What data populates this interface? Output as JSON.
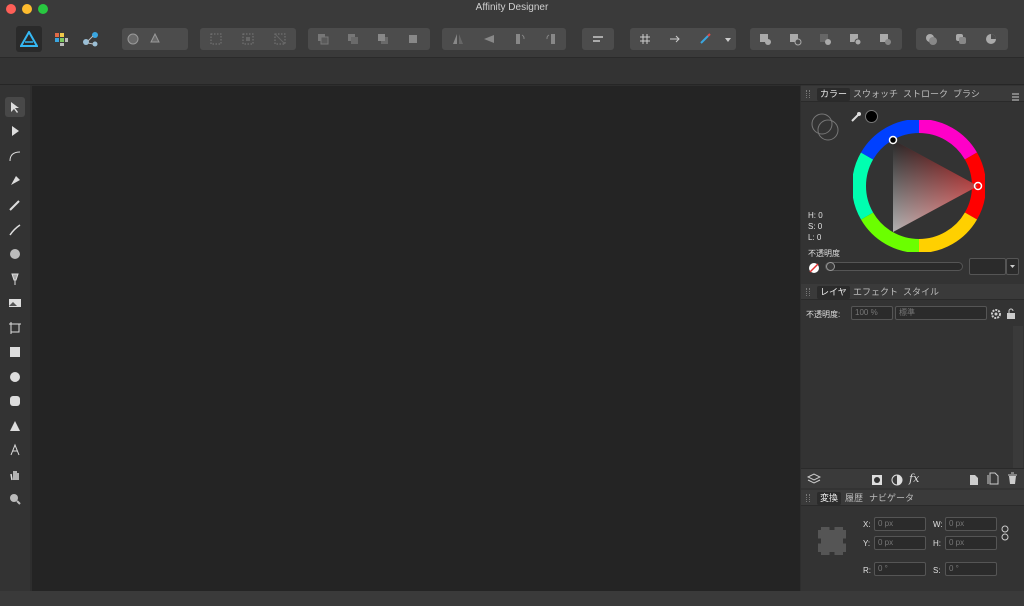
{
  "window": {
    "title": "Affinity Designer"
  },
  "colors": {
    "accent": "#1f8fd6",
    "panel_bg": "#333333",
    "canvas_bg": "#242424",
    "toolbar_bg": "#3a3a3a"
  },
  "color_panel": {
    "tabs": [
      "カラー",
      "スウォッチ",
      "ストローク",
      "ブラシ"
    ],
    "hsl": {
      "h": "H: 0",
      "s": "S: 0",
      "l": "L: 0"
    },
    "opacity_label": "不透明度"
  },
  "layers_panel": {
    "tabs": [
      "レイヤ",
      "エフェクト",
      "スタイル"
    ],
    "opacity_label": "不透明度:",
    "opacity_value": "100 %",
    "blend_mode": "標準"
  },
  "transform_panel": {
    "tabs": [
      "変換",
      "履歴",
      "ナビゲータ"
    ],
    "x_label": "X:",
    "x_value": "0 px",
    "y_label": "Y:",
    "y_value": "0 px",
    "w_label": "W:",
    "w_value": "0 px",
    "h_label": "H:",
    "h_value": "0 px",
    "r_label": "R:",
    "r_value": "0 °",
    "s_label": "S:",
    "s_value": "0 °"
  },
  "layer_footer_icons": {
    "fx_label": "fx"
  }
}
